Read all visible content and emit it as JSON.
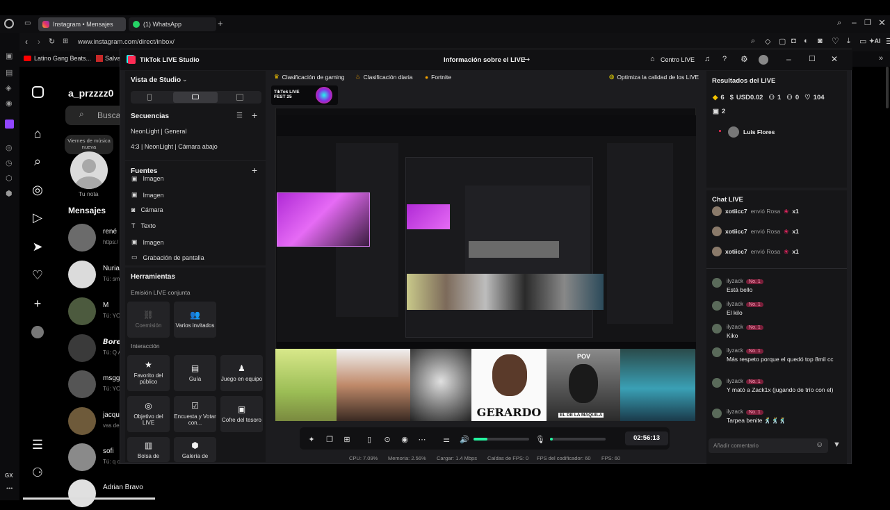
{
  "browser": {
    "tabs": [
      {
        "label": "Instagram • Mensajes"
      },
      {
        "label": "(1) WhatsApp"
      }
    ],
    "url": "www.instagram.com/direct/inbox/",
    "bookmarks": [
      "Latino Gang Beats...",
      "Salva"
    ],
    "sidebar_label": "GX"
  },
  "instagram": {
    "username": "a_przzzz0",
    "search_placeholder": "Buscar",
    "note_bubble": "Viernes de música nueva",
    "your_note": "Tu nota",
    "messages_header": "Mensajes",
    "conversations": [
      {
        "name": "rené",
        "sub": "https:/"
      },
      {
        "name": "Nuria",
        "sub": "Tú: sm"
      },
      {
        "name": "M",
        "sub": "Tú: YO"
      },
      {
        "name": "𝘽𝙤𝙧𝙚",
        "sub": "Tú: Q A"
      },
      {
        "name": "msgg",
        "sub": "Tú: YO"
      },
      {
        "name": "jacqu",
        "sub": "vas des"
      },
      {
        "name": "sofi",
        "sub": "Tú: q c"
      },
      {
        "name": "Adrian Bravo",
        "sub": ""
      }
    ]
  },
  "studio": {
    "app_title": "TikTok LIVE Studio",
    "window_title": "Información sobre el LIVE",
    "centro_live": "Centro LIVE",
    "studio_view": "Vista de Studio",
    "sequences_title": "Secuencias",
    "sequences": [
      "NeonLight | General",
      "4:3 | NeonLight | Cámara abajo"
    ],
    "sources_title": "Fuentes",
    "sources": [
      {
        "icon": "image-icon",
        "label": "Imagen"
      },
      {
        "icon": "image-icon",
        "label": "Imagen"
      },
      {
        "icon": "camera-icon",
        "label": "Cámara"
      },
      {
        "icon": "text-icon",
        "label": "Texto"
      },
      {
        "icon": "image-icon",
        "label": "Imagen"
      },
      {
        "icon": "screen-capture-icon",
        "label": "Grabación de pantalla"
      }
    ],
    "tools_title": "Herramientas",
    "joint_live_title": "Emisión LIVE conjunta",
    "cohost": "Coemisión",
    "multi_guest": "Varios invitados",
    "interaction_title": "Interacción",
    "tools": [
      {
        "icon": "favorite-icon",
        "label": "Favorito del público"
      },
      {
        "icon": "guide-icon",
        "label": "Guía"
      },
      {
        "icon": "team-game-icon",
        "label": "Juego en equipo"
      },
      {
        "icon": "target-icon",
        "label": "Objetivo del LIVE"
      },
      {
        "icon": "poll-icon",
        "label": "Encuesta y Votar con..."
      },
      {
        "icon": "treasure-icon",
        "label": "Cofre del tesoro"
      },
      {
        "icon": "bag-icon",
        "label": "Bolsa de"
      },
      {
        "icon": "gallery-icon",
        "label": "Galería de"
      }
    ],
    "chips": [
      "Clasificación de gaming",
      "Clasificación diaria",
      "Fortnite"
    ],
    "optimize": "Optimiza la calidad de los LIVE",
    "fest_badge": "TikTok LIVE FEST 25",
    "camera_labels": [
      "GERARDO",
      "POV",
      "EL DE LA MAQUILA"
    ],
    "timer": "02:56:13",
    "volume_level": 0.25,
    "mic_level": 0.05,
    "stats": [
      {
        "label": "CPU:",
        "value": "7.09%"
      },
      {
        "label": "Memoria:",
        "value": "2.56%"
      },
      {
        "label": "Cargar:",
        "value": "1.4 Mbps"
      },
      {
        "label": "Caídas de FPS:",
        "value": "0"
      },
      {
        "label": "FPS del codificador:",
        "value": "60"
      },
      {
        "label": "FPS:",
        "value": "60"
      }
    ]
  },
  "results": {
    "title": "Resultados del LIVE",
    "coins": "6",
    "usd": "USD0.02",
    "viewers": "1",
    "shares": "0",
    "likes": "104",
    "gifts": "2",
    "top_viewer": "Luis Flores"
  },
  "chat": {
    "title": "Chat LIVE",
    "gifts": [
      {
        "user": "xotiicc7",
        "text": "envió Rosa",
        "count": "x1"
      },
      {
        "user": "xotiicc7",
        "text": "envió Rosa",
        "count": "x1"
      },
      {
        "user": "xotiicc7",
        "text": "envió Rosa",
        "count": "x1"
      }
    ],
    "badge": "No. 1",
    "messages": [
      {
        "user": "ilyzack",
        "text": "Está bello"
      },
      {
        "user": "ilyzack",
        "text": "El kilo"
      },
      {
        "user": "ilyzack",
        "text": "Kiko"
      },
      {
        "user": "ilyzack",
        "text": "Más respeto porque el quedó top 8mil cc"
      },
      {
        "user": "ilyzack",
        "text": "Y mató a Zack1x (jugando de trío con el)"
      },
      {
        "user": "ilyzack",
        "text": "Tarpea benite 🕺🕺🕺"
      }
    ],
    "comment_placeholder": "Añadir comentario"
  }
}
